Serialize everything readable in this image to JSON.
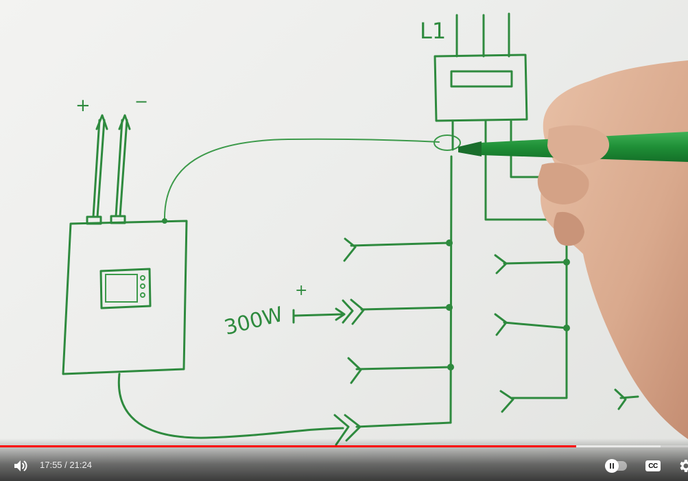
{
  "player": {
    "current_time": "17:55",
    "separator": " / ",
    "duration": "21:24",
    "progress_fraction": 0.837,
    "buffered_fraction": 0.96,
    "cc_label": "CC",
    "accent_color": "#ff0000",
    "icons": {
      "volume": "volume-icon",
      "autoplay": "pause-toggle-icon",
      "captions": "captions-icon",
      "settings": "gear-icon"
    }
  },
  "video": {
    "handwritten_labels": {
      "plus": "+",
      "minus": "−",
      "phase": "L1",
      "power": "300W",
      "power_mark": "+"
    },
    "ink_color": "#2e8a3e"
  }
}
